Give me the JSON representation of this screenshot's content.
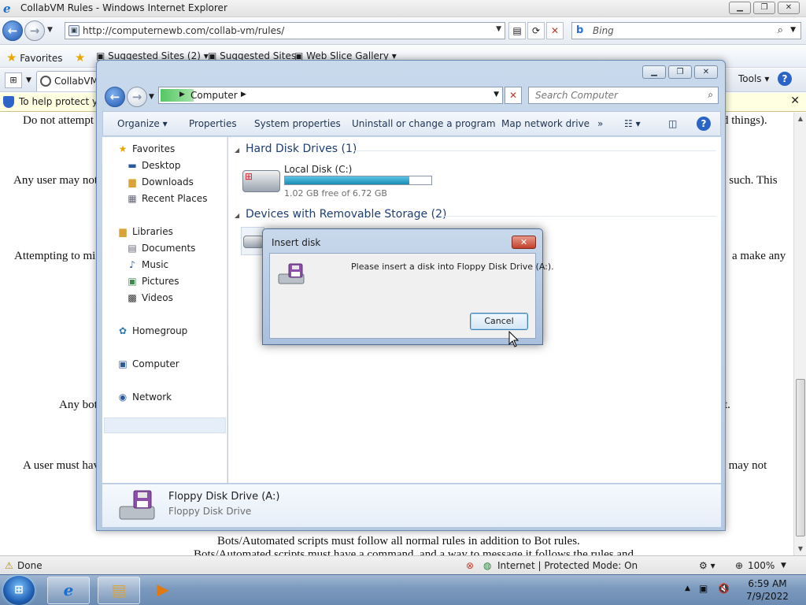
{
  "ie": {
    "window_title": "CollabVM Rules - Windows Internet Explorer",
    "address_url": "http://computernewb.com/collab-vm/rules/",
    "search_placeholder": "Bing",
    "favorites_bar": {
      "favorites_label": "Favorites",
      "suggested_sites": "Suggested Sites (2) ▾",
      "suggested_sites_2": "Suggested Sites",
      "web_slice_gallery": "Web Slice Gallery ▾"
    },
    "tab_label": "CollabVM Rules",
    "tools_label": "Tools ▾",
    "infobar_text": "To help protect yo",
    "status": {
      "done": "Done",
      "zone": "Internet | Protected Mode: On",
      "zoom": "100%"
    },
    "page_lines": [
      {
        "left": "Do not attempt",
        "right": "d things)."
      },
      {
        "left": "Any user may not",
        "right": "o such. This"
      },
      {
        "left": "Attempting to mi",
        "right": "a make any"
      },
      {
        "left": "Any bot",
        "right": "t."
      },
      {
        "left": "A user must hav",
        "right": "s may not"
      }
    ],
    "bottom_line_1": "Bots/Automated scripts must follow all normal rules in addition to Bot rules.",
    "bottom_line_2": "Bots/Automated scripts must have a command, and a way to message it follows the rules and"
  },
  "explorer": {
    "breadcrumb": "Computer",
    "search_placeholder": "Search Computer",
    "commands": {
      "organize": "Organize ▾",
      "properties": "Properties",
      "system_properties": "System properties",
      "uninstall": "Uninstall or change a program",
      "map_drive": "Map network drive",
      "more": "»"
    },
    "nav": {
      "favorites": "Favorites",
      "desktop": "Desktop",
      "downloads": "Downloads",
      "recent_places": "Recent Places",
      "libraries": "Libraries",
      "documents": "Documents",
      "music": "Music",
      "pictures": "Pictures",
      "videos": "Videos",
      "homegroup": "Homegroup",
      "computer": "Computer",
      "network": "Network"
    },
    "groups": {
      "hdd": "Hard Disk Drives (1)",
      "removable": "Devices with Removable Storage (2)"
    },
    "local_disk": {
      "name": "Local Disk (C:)",
      "free_text": "1.02 GB free of 6.72 GB",
      "used_fraction": 0.85
    },
    "details": {
      "name": "Floppy Disk Drive (A:)",
      "type": "Floppy Disk Drive"
    }
  },
  "dialog": {
    "title": "Insert disk",
    "message": "Please insert a disk into Floppy Disk Drive (A:).",
    "cancel_label": "Cancel",
    "close_glyph": "✕"
  },
  "taskbar": {
    "time": "6:59 AM",
    "date": "7/9/2022"
  }
}
